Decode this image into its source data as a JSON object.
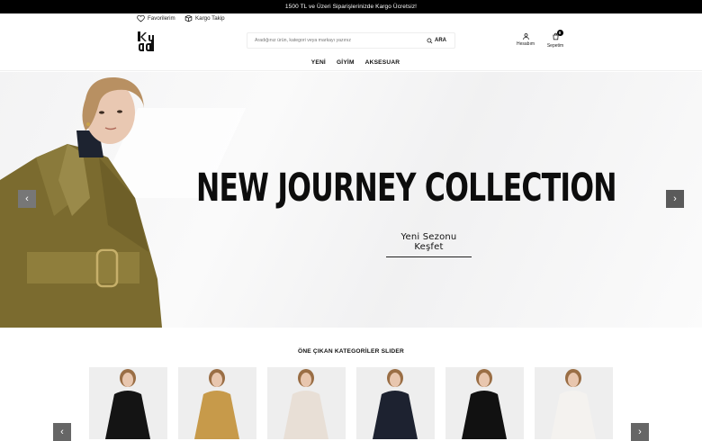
{
  "announcement": "1500 TL ve Üzeri Siparişlerinizde Kargo Ücretsiz!",
  "utility": {
    "favorites": "Favorilerim",
    "tracking": "Kargo Takip"
  },
  "logo": "kuad",
  "search": {
    "placeholder": "Aradığınız ürün, kategori veya markayı yazınız",
    "button": "ARA"
  },
  "account": {
    "label": "Hesabım"
  },
  "cart": {
    "label": "Sepetim",
    "count": "0"
  },
  "nav": [
    "YENİ",
    "GİYİM",
    "AKSESUAR"
  ],
  "hero": {
    "title": "NEW JOURNEY COLLECTION",
    "cta": "Yeni Sezonu Keşfet",
    "prev": "‹",
    "next": "›"
  },
  "categories": {
    "title": "ÖNE ÇIKAN KATEGORİLER SLIDER",
    "prev": "‹",
    "next": "›",
    "items": [
      {
        "name": "black-coat",
        "color": "#141414"
      },
      {
        "name": "mustard-ruffle",
        "color": "#c79a4a"
      },
      {
        "name": "beige-coat",
        "color": "#e8dfd6"
      },
      {
        "name": "navy-trench",
        "color": "#1d2230"
      },
      {
        "name": "black-cape",
        "color": "#111111"
      },
      {
        "name": "white-dress",
        "color": "#f4f2ef"
      }
    ]
  },
  "colors": {
    "accent": "#000000",
    "trench": "#7a6a30"
  }
}
